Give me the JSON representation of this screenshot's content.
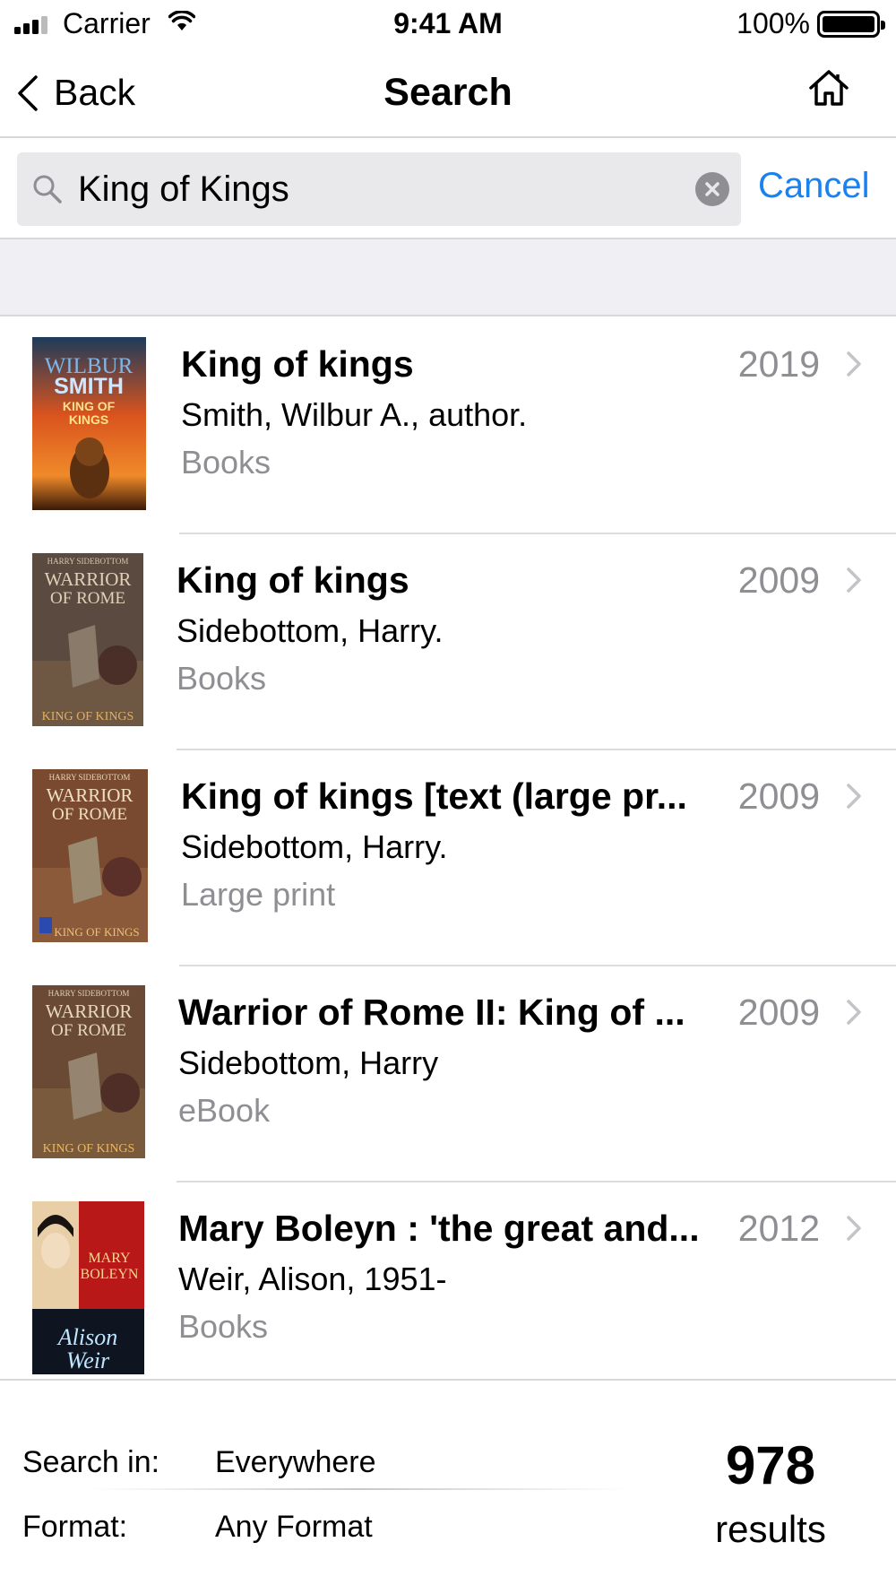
{
  "status_bar": {
    "carrier": "Carrier",
    "time": "9:41 AM",
    "battery": "100%"
  },
  "nav": {
    "back_label": "Back",
    "title": "Search",
    "home_icon": "home-icon"
  },
  "search": {
    "query": "King of Kings",
    "cancel_label": "Cancel"
  },
  "results": [
    {
      "title": "King of kings",
      "year": "2019",
      "author": "Smith, Wilbur A., author.",
      "format": "Books",
      "cover": {
        "line1": "WILBUR",
        "line2": "SMITH",
        "line3": "KING OF",
        "line4": "KINGS"
      }
    },
    {
      "title": "King of kings",
      "year": "2009",
      "author": "Sidebottom, Harry.",
      "format": "Books",
      "cover": {
        "line1": "HARRY SIDEBOTTOM",
        "line2": "WARRIOR",
        "line3": "OF ROME",
        "line4": "KING OF KINGS"
      }
    },
    {
      "title": "King of kings [text (large pr...",
      "year": "2009",
      "author": "Sidebottom, Harry.",
      "format": "Large print",
      "cover": {
        "line1": "HARRY SIDEBOTTOM",
        "line2": "WARRIOR",
        "line3": "OF ROME",
        "line4": "KING OF KINGS"
      }
    },
    {
      "title": "Warrior of Rome II: King of ...",
      "year": "2009",
      "author": "Sidebottom, Harry",
      "format": "eBook",
      "cover": {
        "line1": "HARRY SIDEBOTTOM",
        "line2": "WARRIOR",
        "line3": "OF ROME",
        "line4": "KING OF KINGS"
      }
    },
    {
      "title": "Mary Boleyn : 'the great and...",
      "year": "2012",
      "author": "Weir, Alison, 1951-",
      "format": "Books",
      "cover": {
        "line1": "MARY",
        "line2": "BOLEYN",
        "line3": "Alison",
        "line4": "Weir"
      }
    }
  ],
  "footer": {
    "search_in_label": "Search in:",
    "search_in_value": "Everywhere",
    "format_label": "Format:",
    "format_value": "Any Format",
    "count": "978",
    "count_label": "results"
  },
  "colors": {
    "accent": "#1a82f0",
    "secondary_text": "#8e8e93",
    "search_field_bg": "#e9e9eb",
    "band_bg": "#efeff4"
  }
}
